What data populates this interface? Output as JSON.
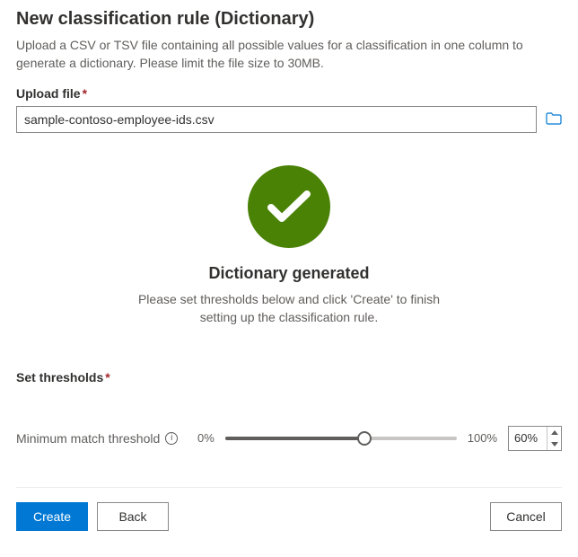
{
  "header": {
    "title": "New classification rule (Dictionary)",
    "desc": "Upload a CSV or TSV file containing all possible values for a classification in one column to generate a dictionary. Please limit the file size to 30MB."
  },
  "upload": {
    "label": "Upload file",
    "filename": "sample-contoso-employee-ids.csv"
  },
  "status": {
    "title": "Dictionary generated",
    "sub": "Please set thresholds below and click 'Create' to finish setting up the classification rule."
  },
  "thresholds": {
    "section_label": "Set thresholds",
    "min_label": "Minimum match threshold",
    "scale_min": "0%",
    "scale_max": "100%",
    "value_pct": 60,
    "value_display": "60%"
  },
  "footer": {
    "create": "Create",
    "back": "Back",
    "cancel": "Cancel"
  }
}
